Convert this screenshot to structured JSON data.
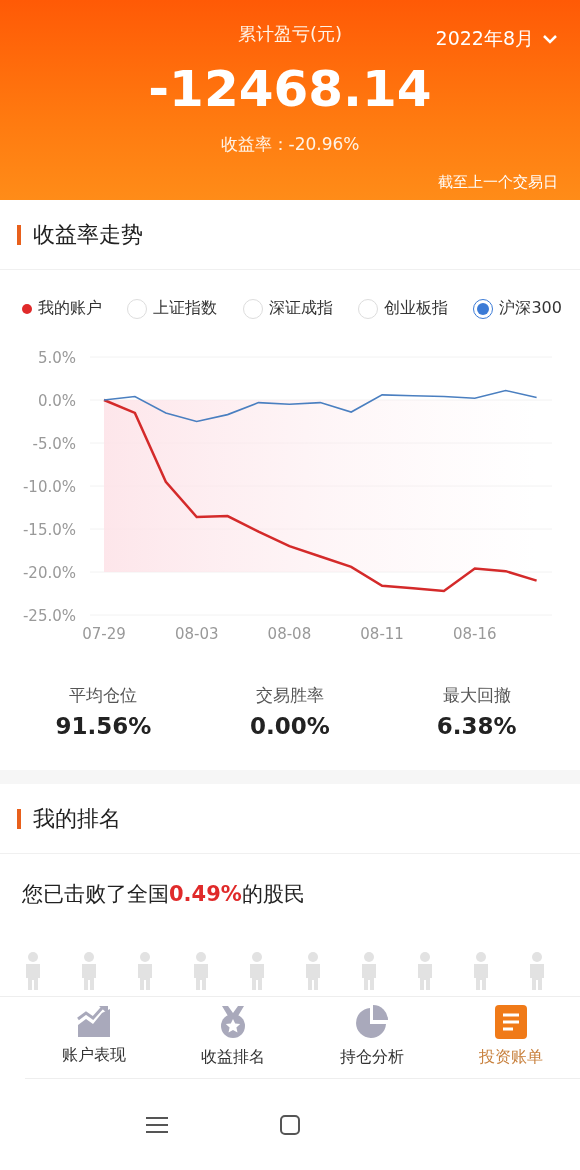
{
  "header": {
    "title": "累计盈亏(元)",
    "month": "2022年8月",
    "amount": "-12468.14",
    "rate_label": "收益率：",
    "rate": "-20.96%",
    "note": "截至上一个交易日"
  },
  "trend": {
    "title": "收益率走势",
    "legend": [
      {
        "kind": "series",
        "label": "我的账户",
        "color": "#e02a2a"
      },
      {
        "kind": "radio",
        "label": "上证指数",
        "selected": false
      },
      {
        "kind": "radio",
        "label": "深证成指",
        "selected": false
      },
      {
        "kind": "radio",
        "label": "创业板指",
        "selected": false
      },
      {
        "kind": "radio",
        "label": "沪深300",
        "selected": true
      }
    ],
    "chart_data": {
      "type": "line",
      "categories": [
        "07-29",
        null,
        null,
        "08-03",
        null,
        null,
        "08-08",
        null,
        null,
        "08-11",
        null,
        null,
        "08-16",
        null,
        null
      ],
      "series": [
        {
          "color": "#d42a2a",
          "values": [
            0,
            -1.5,
            -9.5,
            -13.6,
            -13.5,
            -15.3,
            -17.0,
            -18.2,
            -19.4,
            -21.6,
            -21.9,
            -22.2,
            -19.6,
            -19.9,
            -21.0
          ]
        },
        {
          "color": "#4a7fc0",
          "values": [
            0,
            0.4,
            -1.5,
            -2.5,
            -1.7,
            -0.3,
            -0.5,
            -0.3,
            -1.4,
            0.6,
            0.5,
            0.4,
            0.2,
            1.1,
            0.3
          ]
        }
      ],
      "ylim": [
        -25,
        5
      ],
      "grid": true,
      "bands": [
        {
          "axis": "y",
          "from": -20,
          "to": 0
        }
      ],
      "yticks": [
        {
          "value": 5,
          "label": "5.0%"
        },
        {
          "value": 0,
          "label": "0.0%"
        },
        {
          "value": -5,
          "label": "-5.0%"
        },
        {
          "value": -10,
          "label": "-10.0%"
        },
        {
          "value": -15,
          "label": "-15.0%"
        },
        {
          "value": -20,
          "label": "-20.0%"
        },
        {
          "value": -25,
          "label": "-25.0%"
        }
      ]
    },
    "stats": [
      {
        "label": "平均仓位",
        "value": "91.56%"
      },
      {
        "label": "交易胜率",
        "value": "0.00%"
      },
      {
        "label": "最大回撤",
        "value": "6.38%"
      }
    ]
  },
  "ranking": {
    "title": "我的排名",
    "sentence": "您已击败了全国**0.49%**的股民"
  },
  "tabs": [
    {
      "label": "账户表现",
      "selected": false
    },
    {
      "label": "收益排名",
      "selected": false
    },
    {
      "label": "持仓分析",
      "selected": false
    },
    {
      "label": "投资账单",
      "selected": true
    }
  ]
}
